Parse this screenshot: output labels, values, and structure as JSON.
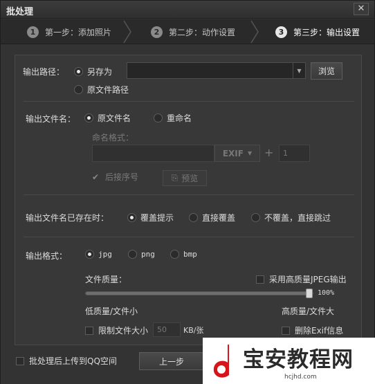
{
  "window": {
    "title": "批处理",
    "close_glyph": "✕"
  },
  "steps": [
    {
      "num": "1",
      "label": "第一步：添加照片",
      "active": false
    },
    {
      "num": "2",
      "label": "第二步：动作设置",
      "active": false
    },
    {
      "num": "3",
      "label": "第三步：输出设置",
      "active": true
    }
  ],
  "output_path": {
    "label": "输出路径：",
    "option_save_as": "另存为",
    "option_original": "原文件路径",
    "path_value": "",
    "browse_label": "浏览"
  },
  "output_filename": {
    "label": "输出文件名：",
    "option_original": "原文件名",
    "option_rename": "重命名",
    "format_label": "命名格式：",
    "exif_label": "EXIF",
    "plus_glyph": "+",
    "start_number": "1",
    "append_seq_label": "后接序号",
    "preview_label": "预览"
  },
  "file_exists": {
    "label": "输出文件名已存在时：",
    "option_prompt": "覆盖提示",
    "option_overwrite": "直接覆盖",
    "option_skip": "不覆盖，直接跳过"
  },
  "output_format": {
    "label": "输出格式：",
    "option_jpg": "jpg",
    "option_png": "png",
    "option_bmp": "bmp",
    "quality_label": "文件质量：",
    "hq_jpeg_label": "采用高质量JPEG输出",
    "quality_value": "100%",
    "quality_fraction": 1.0,
    "low_quality_label": "低质量/文件小",
    "high_quality_label": "高质量/文件大",
    "limit_size_label": "限制文件大小",
    "limit_size_value": "50",
    "limit_size_unit": "KB/张",
    "delete_exif_label": "删除Exif信息"
  },
  "bottom": {
    "upload_qq_label": "批处理后上传到QQ空间",
    "prev_label": "上一步"
  },
  "watermark": {
    "text": "宝安教程网",
    "url": "hcjhd.com"
  }
}
